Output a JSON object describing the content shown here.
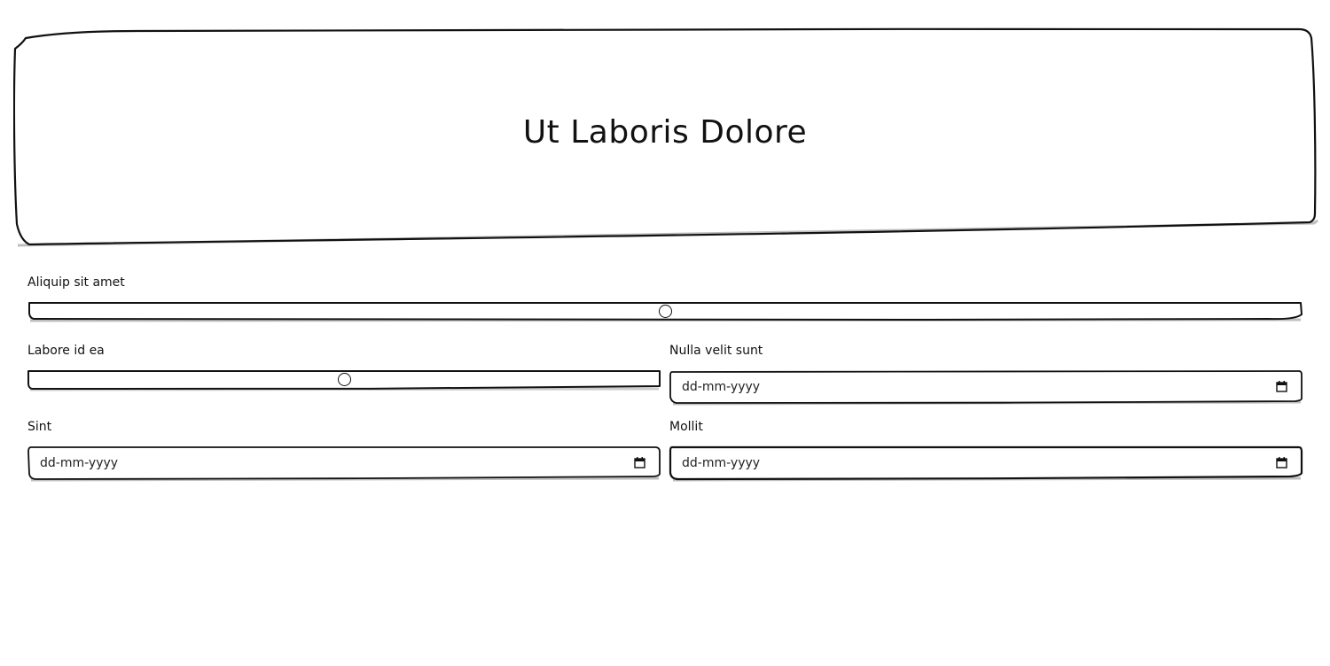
{
  "header": {
    "title": "Ut Laboris Dolore"
  },
  "fields": {
    "aliquip": {
      "label": "Aliquip sit amet",
      "value_fraction": 0.5
    },
    "labore": {
      "label": "Labore id ea",
      "value_fraction": 0.5
    },
    "nulla": {
      "label": "Nulla velit sunt",
      "placeholder": "dd-mm-yyyy"
    },
    "sint": {
      "label": "Sint",
      "placeholder": "dd-mm-yyyy"
    },
    "mollit": {
      "label": "Mollit",
      "placeholder": "dd-mm-yyyy"
    }
  },
  "icons": {
    "date_picker": "calendar-icon",
    "slider_thumb": "circle-thumb"
  },
  "colors": {
    "stroke": "#111111",
    "background": "#ffffff"
  }
}
